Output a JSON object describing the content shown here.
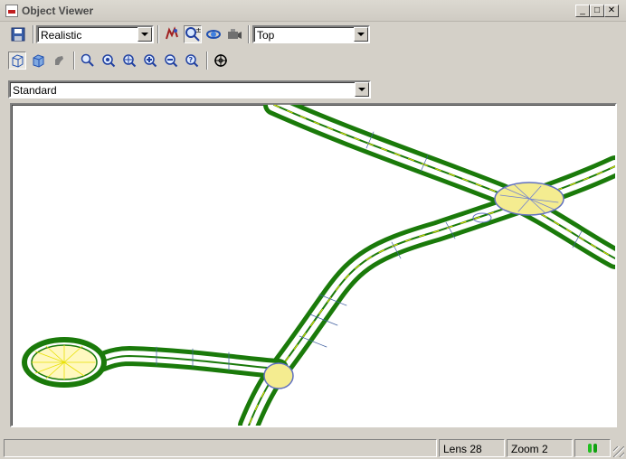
{
  "window": {
    "title": "Object Viewer"
  },
  "toolbar1": {
    "visual_style": "Realistic",
    "view_direction": "Top",
    "buttons": [
      "save-icon",
      "pan-icon",
      "zoom-icon",
      "orbit-icon",
      "camera-icon"
    ]
  },
  "toolbar2": {
    "buttons": [
      "wireframe-cube-icon",
      "solid-cube-icon",
      "hand-icon",
      "zoom-window-icon",
      "zoom-extents-icon",
      "zoom-center-icon",
      "zoom-in-icon",
      "zoom-out-icon",
      "zoom-previous-icon",
      "target-icon"
    ]
  },
  "view_style": {
    "value": "Standard"
  },
  "status": {
    "lens": "Lens 28",
    "zoom": "Zoom 2"
  },
  "colors": {
    "road_green": "#1a7a0a",
    "road_yellow": "#e8e000",
    "road_blue": "#4060c0"
  }
}
